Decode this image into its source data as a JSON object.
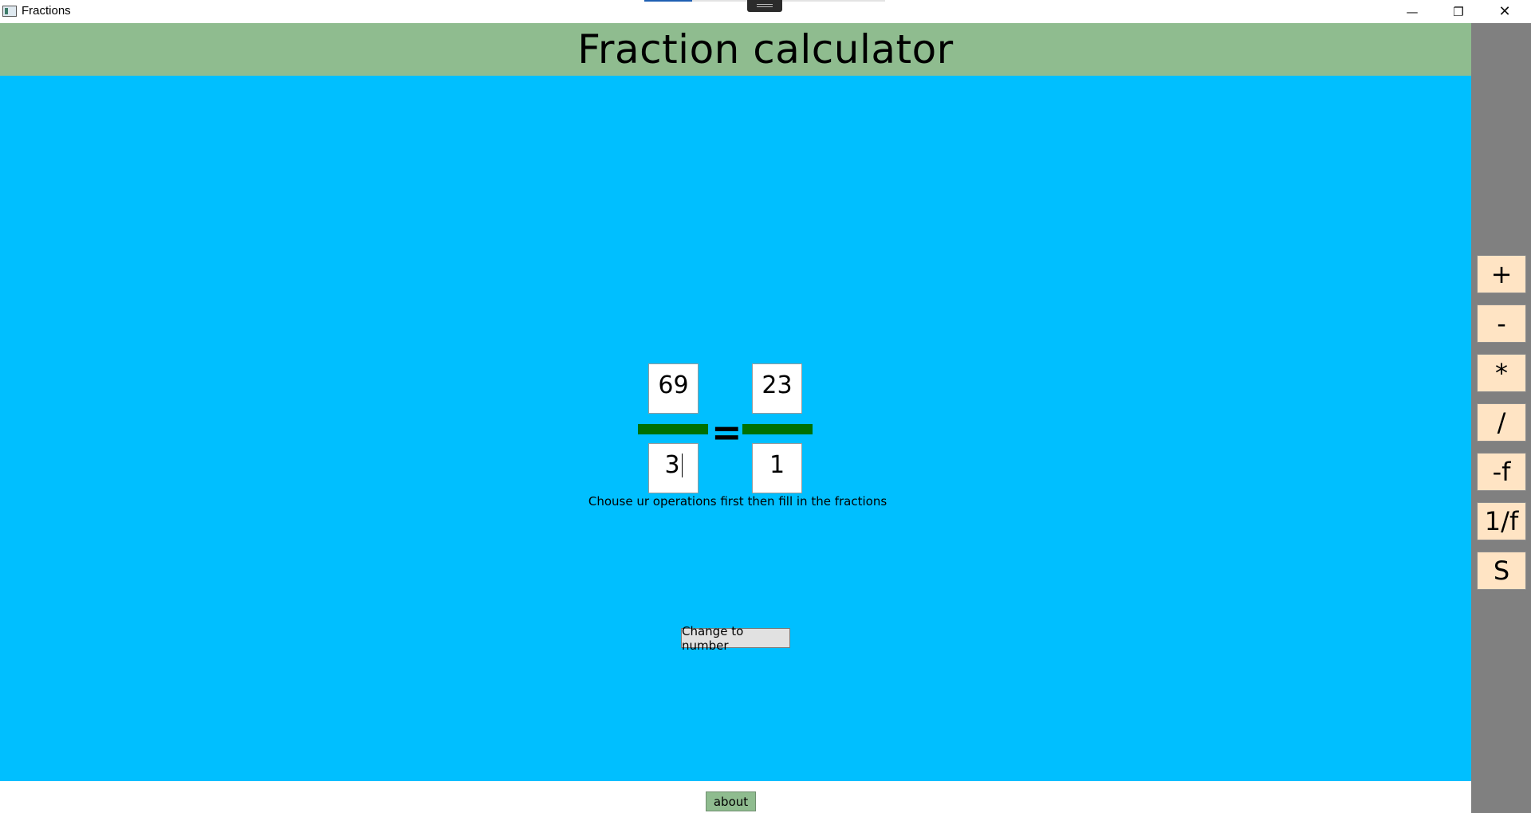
{
  "window": {
    "title": "Fractions",
    "minimize_glyph": "—",
    "maximize_glyph": "❐",
    "close_glyph": "✕"
  },
  "header": {
    "title": "Fraction calculator"
  },
  "fraction_left": {
    "numerator": "69",
    "denominator": "3"
  },
  "fraction_right": {
    "numerator": "23",
    "denominator": "1"
  },
  "equals": "=",
  "hint": "Chouse ur operations first then fill in the fractions",
  "change_button_label": "Change to number",
  "operations": [
    "+",
    "-",
    "*",
    "/",
    "-f",
    "1/f",
    "S"
  ],
  "footer": {
    "about_label": "about"
  },
  "colors": {
    "header_bg": "#8fbc8f",
    "main_bg": "#00bfff",
    "sidebar_bg": "#808080",
    "op_button_bg": "#ffe4c4",
    "fraction_bar": "#007000"
  },
  "icons": {
    "app": "app-window-icon",
    "minimize": "minimize-icon",
    "maximize": "restore-icon",
    "close": "close-icon"
  }
}
